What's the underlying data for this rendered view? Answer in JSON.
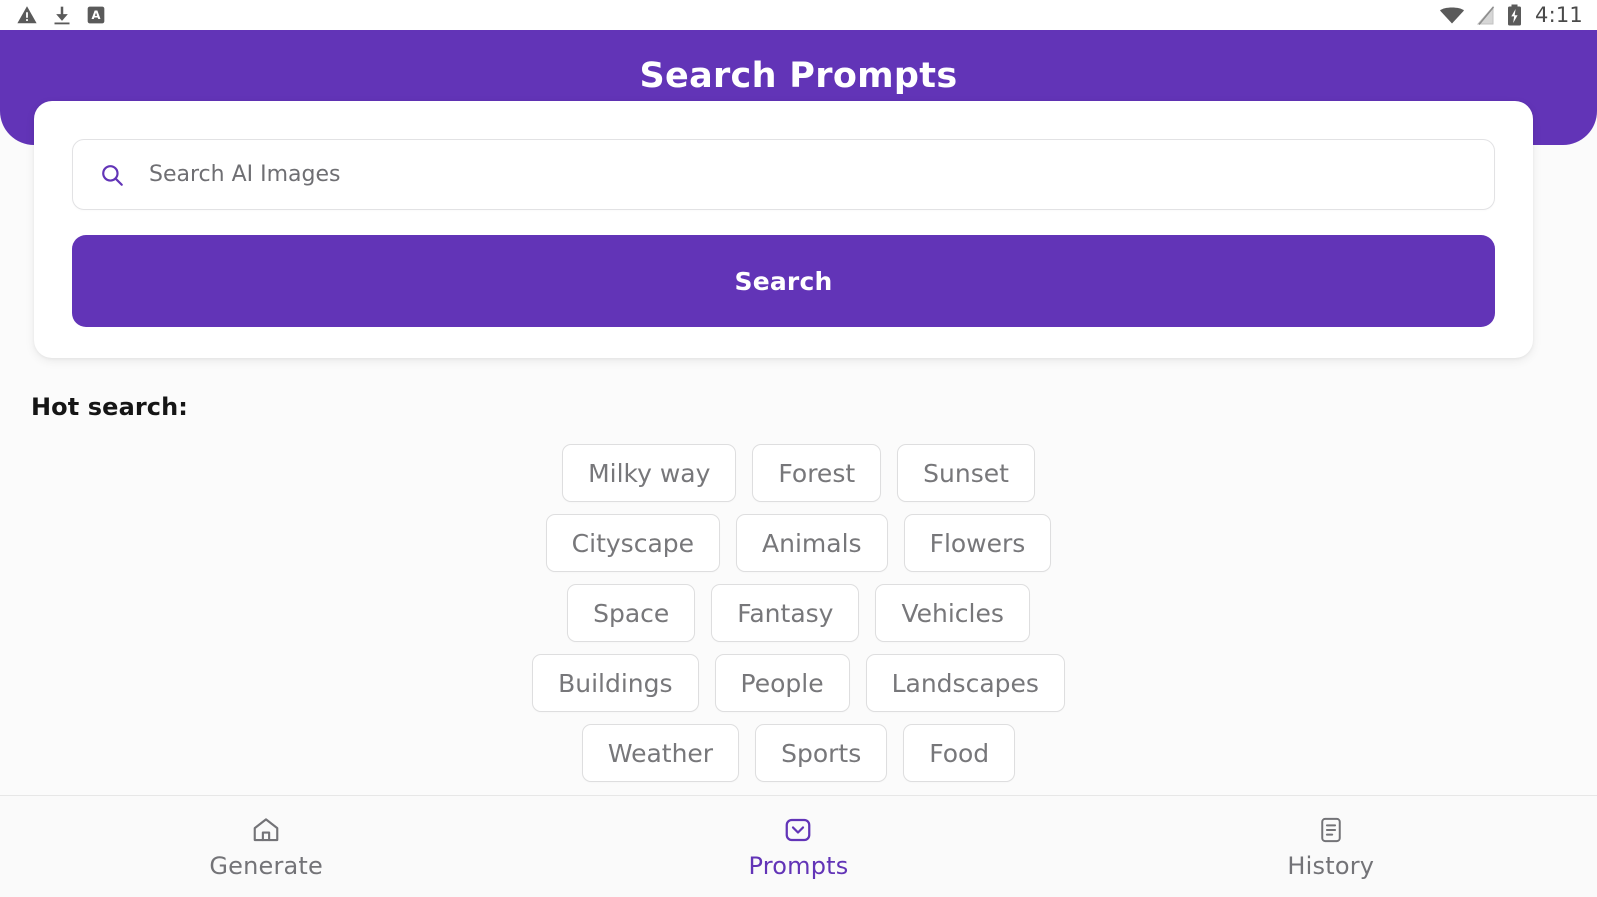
{
  "status_bar": {
    "icons": [
      "warning-triangle-icon",
      "download-icon",
      "screenshot-a-icon"
    ],
    "right_icons": [
      "wifi-icon",
      "signal-off-icon",
      "battery-charging-icon"
    ],
    "time": "4:11"
  },
  "header": {
    "title": "Search Prompts",
    "background_color": "#6234B7"
  },
  "search": {
    "placeholder": "Search AI Images",
    "value": "",
    "icon": "search-icon",
    "button_label": "Search",
    "button_color": "#6234B7"
  },
  "hot_search": {
    "label": "Hot search:",
    "rows": [
      [
        "Milky way",
        "Forest",
        "Sunset"
      ],
      [
        "Cityscape",
        "Animals",
        "Flowers"
      ],
      [
        "Space",
        "Fantasy",
        "Vehicles"
      ],
      [
        "Buildings",
        "People",
        "Landscapes"
      ],
      [
        "Weather",
        "Sports",
        "Food"
      ]
    ]
  },
  "bottom_nav": {
    "active_color": "#6234B7",
    "inactive_color": "#737377",
    "items": [
      {
        "label": "Generate",
        "icon": "home-icon",
        "active": false
      },
      {
        "label": "Prompts",
        "icon": "chevron-square-icon",
        "active": true
      },
      {
        "label": "History",
        "icon": "document-lines-icon",
        "active": false
      }
    ]
  }
}
